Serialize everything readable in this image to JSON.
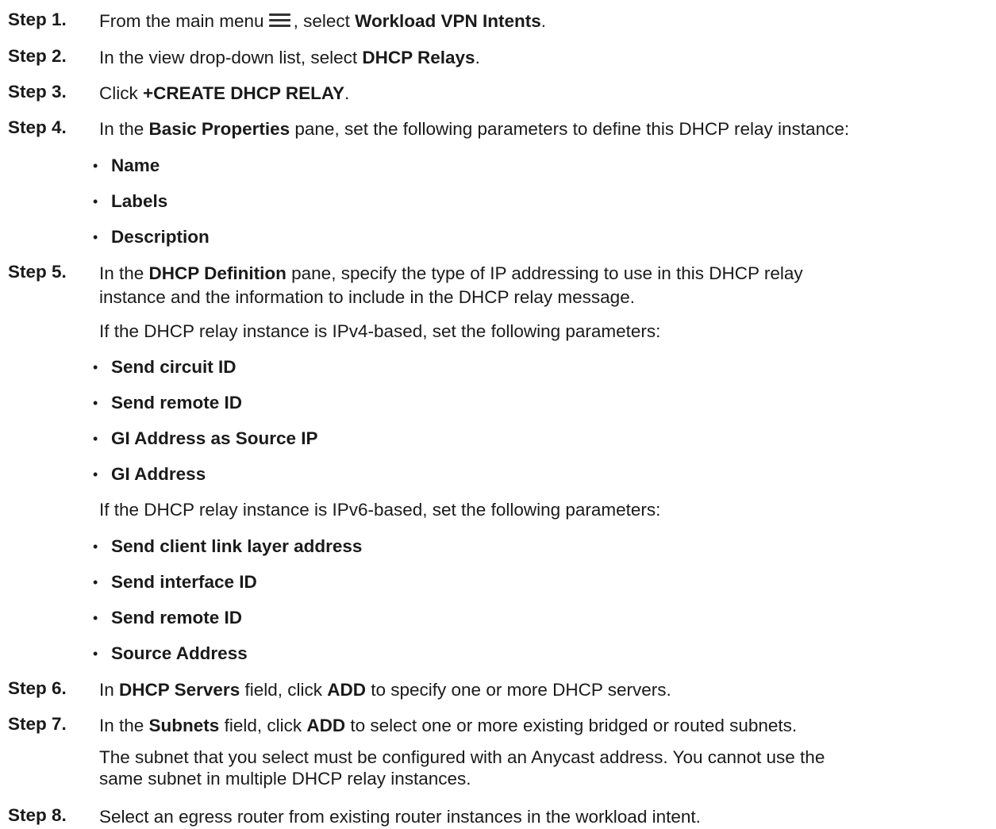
{
  "steps": {
    "s1": {
      "label": "Step 1.",
      "pre": "From the main menu",
      "mid": ", select ",
      "bold": "Workload VPN Intents",
      "post": "."
    },
    "s2": {
      "label": "Step 2.",
      "pre": "In the view drop-down list, select ",
      "bold": "DHCP Relays",
      "post": "."
    },
    "s3": {
      "label": "Step 3.",
      "pre": "Click ",
      "bold": "+CREATE DHCP RELAY",
      "post": "."
    },
    "s4": {
      "label": "Step 4.",
      "pre": "In the ",
      "bold": "Basic Properties",
      "post": " pane, set the following parameters to define this DHCP relay instance:",
      "bullets": [
        "Name",
        "Labels",
        "Description"
      ]
    },
    "s5": {
      "label": "Step 5.",
      "pre": "In the ",
      "bold": "DHCP Definition",
      "line1_post": " pane, specify the type of IP addressing to use in this DHCP relay",
      "line2": "instance and the information to include in the DHCP relay message.",
      "ipv4_intro": "If the DHCP relay instance is IPv4-based, set the following parameters:",
      "ipv4_bullets": [
        "Send circuit ID",
        "Send remote ID",
        "GI Address as Source IP",
        "GI Address"
      ],
      "ipv6_intro": "If the DHCP relay instance is IPv6-based, set the following parameters:",
      "ipv6_bullets": [
        "Send client link layer address",
        "Send interface ID",
        "Send remote ID",
        "Source Address"
      ]
    },
    "s6": {
      "label": "Step 6.",
      "pre": "In ",
      "bold": "DHCP Servers",
      "mid": " field, click ",
      "bold2": "ADD",
      "post": " to specify one or more DHCP servers."
    },
    "s7": {
      "label": "Step 7.",
      "pre": "In the ",
      "bold": "Subnets",
      "mid": " field, click ",
      "bold2": "ADD",
      "post": " to select one or more existing bridged or routed subnets.",
      "note_line1": "The subnet that you select must be configured with an Anycast address. You cannot use the",
      "note_line2": "same subnet in multiple DHCP relay instances."
    },
    "s8": {
      "label": "Step 8.",
      "text": "Select an egress router from existing router instances in the workload intent."
    }
  },
  "bullet_char": "•",
  "icons": {
    "menu": "hamburger-menu-icon"
  }
}
